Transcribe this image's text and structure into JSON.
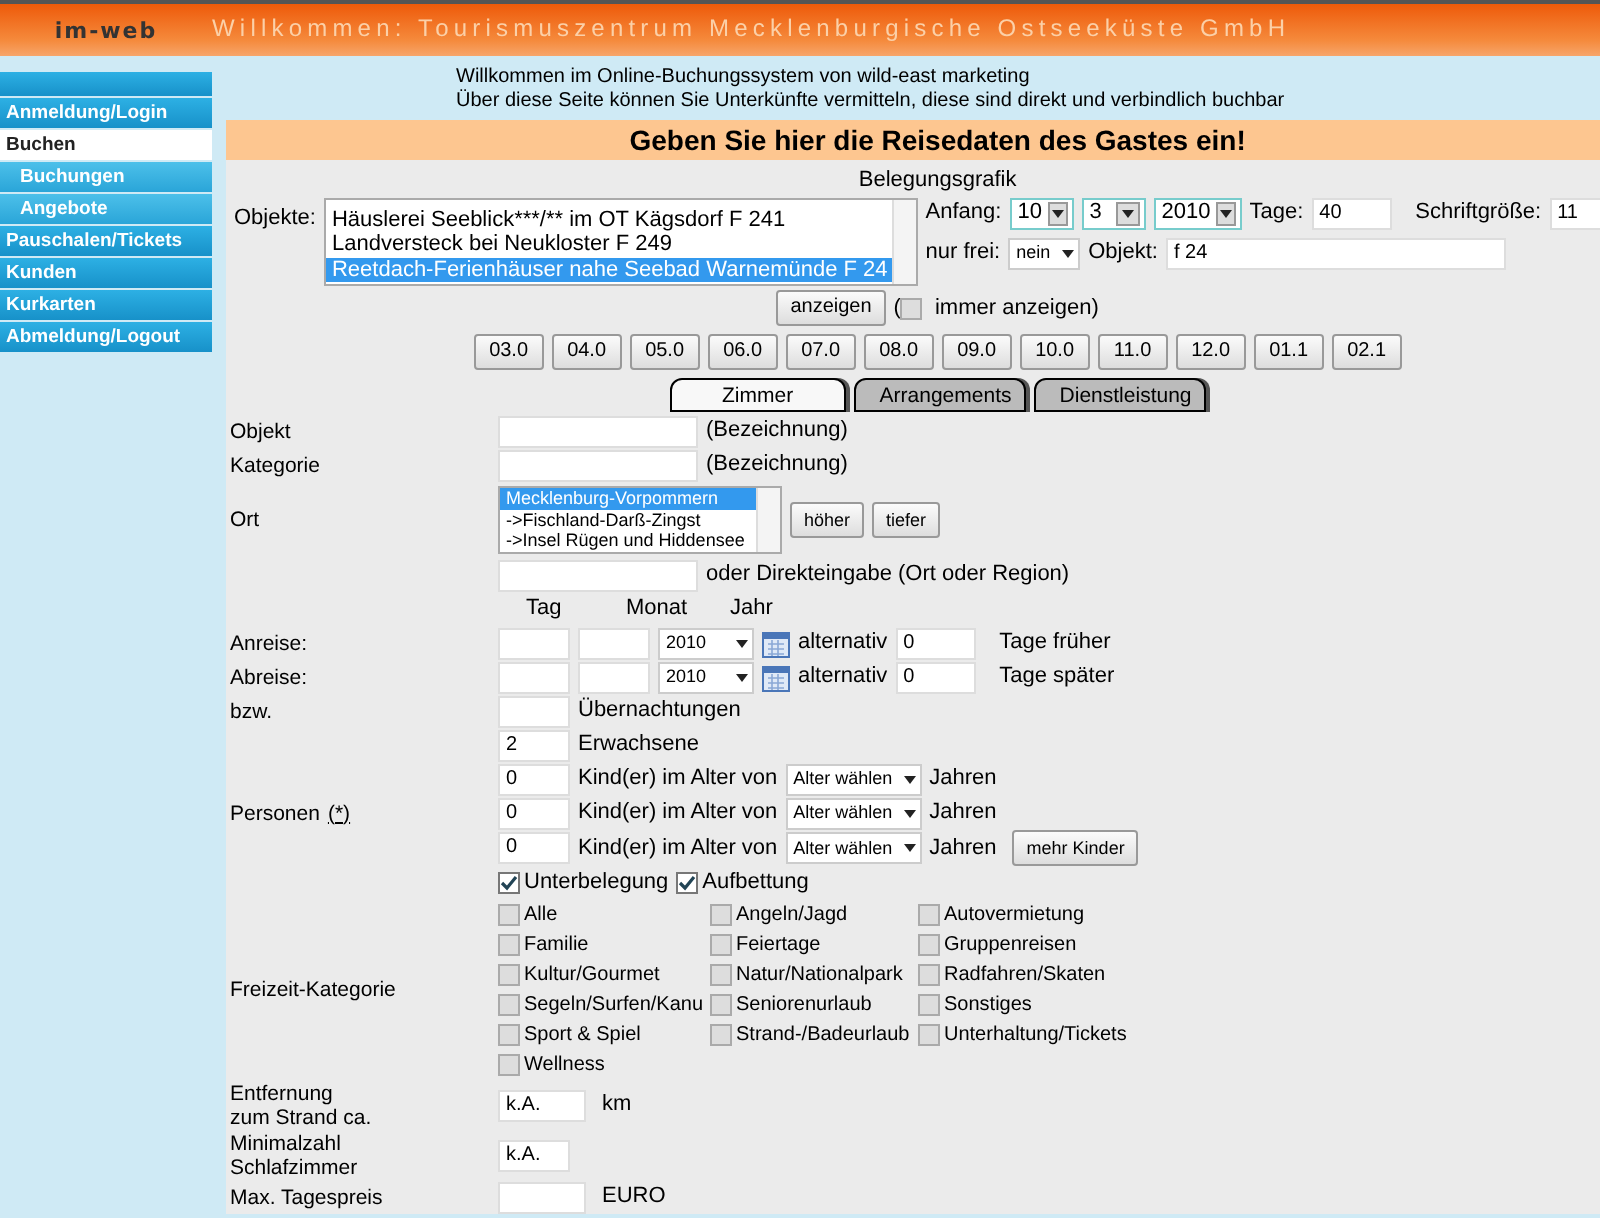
{
  "header": {
    "logo": "im-web",
    "title": "Willkommen: Tourismuszentrum Mecklenburgische Ostseeküste GmbH"
  },
  "sidebar": {
    "items": [
      {
        "label": "Anmeldung/Login",
        "kind": "main",
        "selected": false
      },
      {
        "label": "Buchen",
        "kind": "main",
        "selected": true
      },
      {
        "label": "Buchungen",
        "kind": "sub",
        "selected": false
      },
      {
        "label": "Angebote",
        "kind": "sub",
        "selected": false
      },
      {
        "label": "Pauschalen/Tickets",
        "kind": "main",
        "selected": false
      },
      {
        "label": "Kunden",
        "kind": "main",
        "selected": false
      },
      {
        "label": "Kurkarten",
        "kind": "main",
        "selected": false
      },
      {
        "label": "Abmeldung/Logout",
        "kind": "main",
        "selected": false
      }
    ]
  },
  "intro": [
    "Willkommen im Online-Buchungssystem von wild-east marketing",
    "Über diese Seite können Sie Unterkünfte vermitteln, diese sind direkt und verbindlich buchbar"
  ],
  "heading": "Geben Sie hier die Reisedaten des Gastes ein!",
  "grafik": {
    "title": "Belegungsgrafik",
    "objects_label": "Objekte:",
    "objects": [
      {
        "text": "Häuslerei Seeblick***/** im OT Kägsdorf F 241",
        "selected": false
      },
      {
        "text": "Landversteck bei Neukloster F 249",
        "selected": false
      },
      {
        "text": "Reetdach-Ferienhäuser nahe Seebad Warnemünde F 24",
        "selected": true
      }
    ],
    "start_label": "Anfang:",
    "day": "10",
    "month": "3",
    "year": "2010",
    "days_label": "Tage:",
    "days": "40",
    "font_label": "Schriftgröße:",
    "font_size": "11",
    "free_label": "nur frei:",
    "free": "nein",
    "object_label": "Objekt:",
    "object": "f 24",
    "show_button": "anzeigen",
    "paren": "(",
    "always_label": "immer anzeigen)",
    "always": false,
    "months": [
      "03.0",
      "04.0",
      "05.0",
      "06.0",
      "07.0",
      "08.0",
      "09.0",
      "10.0",
      "11.0",
      "12.0",
      "01.1",
      "02.1"
    ]
  },
  "tabs": [
    {
      "label": "Zimmer",
      "selected": true
    },
    {
      "label": "Arrangements",
      "selected": false
    },
    {
      "label": "Dienstleistung",
      "selected": false
    }
  ],
  "form": {
    "objekt": {
      "label": "Objekt",
      "suffix": "(Bezeichnung)"
    },
    "kategorie": {
      "label": "Kategorie",
      "suffix": "(Bezeichnung)"
    },
    "ort": {
      "label": "Ort",
      "options": [
        {
          "text": "Mecklenburg-Vorpommern",
          "selected": true
        },
        {
          "text": "->Fischland-Darß-Zingst",
          "selected": false
        },
        {
          "text": "->Insel Rügen und Hiddensee",
          "selected": false
        }
      ],
      "buttons": [
        "höher",
        "tiefer"
      ],
      "direct_suffix": "oder Direkteingabe (Ort oder Region)"
    },
    "date_headers": [
      "Tag",
      "Monat",
      "Jahr"
    ],
    "dates": [
      {
        "label": "Anreise:",
        "year": "2010",
        "alt_label": "alternativ",
        "alt_value": "0",
        "suffix": "Tage früher"
      },
      {
        "label": "Abreise:",
        "year": "2010",
        "alt_label": "alternativ",
        "alt_value": "0",
        "suffix": "Tage später"
      }
    ],
    "nights": {
      "label": "bzw.",
      "suffix": "Übernachtungen"
    },
    "persons": {
      "label": "Personen",
      "note": "(*)",
      "adults": "2",
      "adults_suffix": "Erwachsene",
      "children": [
        {
          "value": "0",
          "text": "Kind(er) im Alter von",
          "select": "Alter wählen",
          "suffix": "Jahren"
        },
        {
          "value": "0",
          "text": "Kind(er) im Alter von",
          "select": "Alter wählen",
          "suffix": "Jahren"
        },
        {
          "value": "0",
          "text": "Kind(er) im Alter von",
          "select": "Alter wählen",
          "suffix": "Jahren"
        }
      ],
      "more_button": "mehr Kinder"
    },
    "flags": [
      {
        "label": "Unterbelegung",
        "checked": true
      },
      {
        "label": "Aufbettung",
        "checked": true
      }
    ],
    "leisure": {
      "label": "Freizeit-Kategorie",
      "items": [
        {
          "label": "Alle",
          "checked": false
        },
        {
          "label": "Angeln/Jagd",
          "checked": false
        },
        {
          "label": "Autovermietung",
          "checked": false
        },
        {
          "label": "Familie",
          "checked": false
        },
        {
          "label": "Feiertage",
          "checked": false
        },
        {
          "label": "Gruppenreisen",
          "checked": false
        },
        {
          "label": "Kultur/Gourmet",
          "checked": false
        },
        {
          "label": "Natur/Nationalpark",
          "checked": false
        },
        {
          "label": "Radfahren/Skaten",
          "checked": false
        },
        {
          "label": "Segeln/Surfen/Kanu",
          "checked": false
        },
        {
          "label": "Seniorenurlaub",
          "checked": false
        },
        {
          "label": "Sonstiges",
          "checked": false
        },
        {
          "label": "Sport & Spiel",
          "checked": false
        },
        {
          "label": "Strand-/Badeurlaub",
          "checked": false
        },
        {
          "label": "Unterhaltung/Tickets",
          "checked": false
        },
        {
          "label": "Wellness",
          "checked": false
        }
      ]
    },
    "distance": {
      "label": [
        "Entfernung",
        "zum Strand ca."
      ],
      "value": "k.A.",
      "suffix": "km"
    },
    "bedrooms": {
      "label": [
        "Minimalzahl",
        "Schlafzimmer"
      ],
      "value": "k.A."
    },
    "price": {
      "label": "Max. Tagespreis",
      "suffix": "EURO"
    }
  }
}
